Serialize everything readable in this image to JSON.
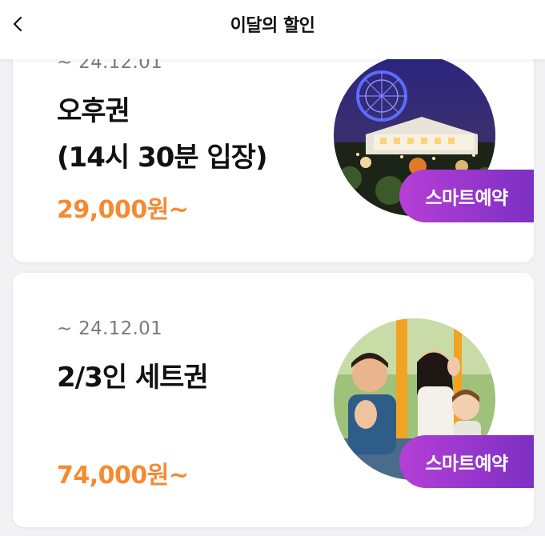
{
  "header": {
    "title": "이달의 할인",
    "back_icon": "chevron-left-icon"
  },
  "cards": [
    {
      "date": "~ 24.12.01",
      "title": "오후권\n(14시 30분 입장)",
      "price": "29,000원~",
      "button_label": "스마트예약",
      "image": "ferris-wheel-night-photo"
    },
    {
      "date": "~ 24.12.01",
      "title": "2/3인 세트권",
      "price": "74,000원~",
      "button_label": "스마트예약",
      "image": "family-waving-photo"
    }
  ],
  "colors": {
    "price": "#f58a32",
    "button_gradient_start": "#b53fd6",
    "button_gradient_end": "#7d2fc4",
    "background": "#f2f2f4"
  }
}
